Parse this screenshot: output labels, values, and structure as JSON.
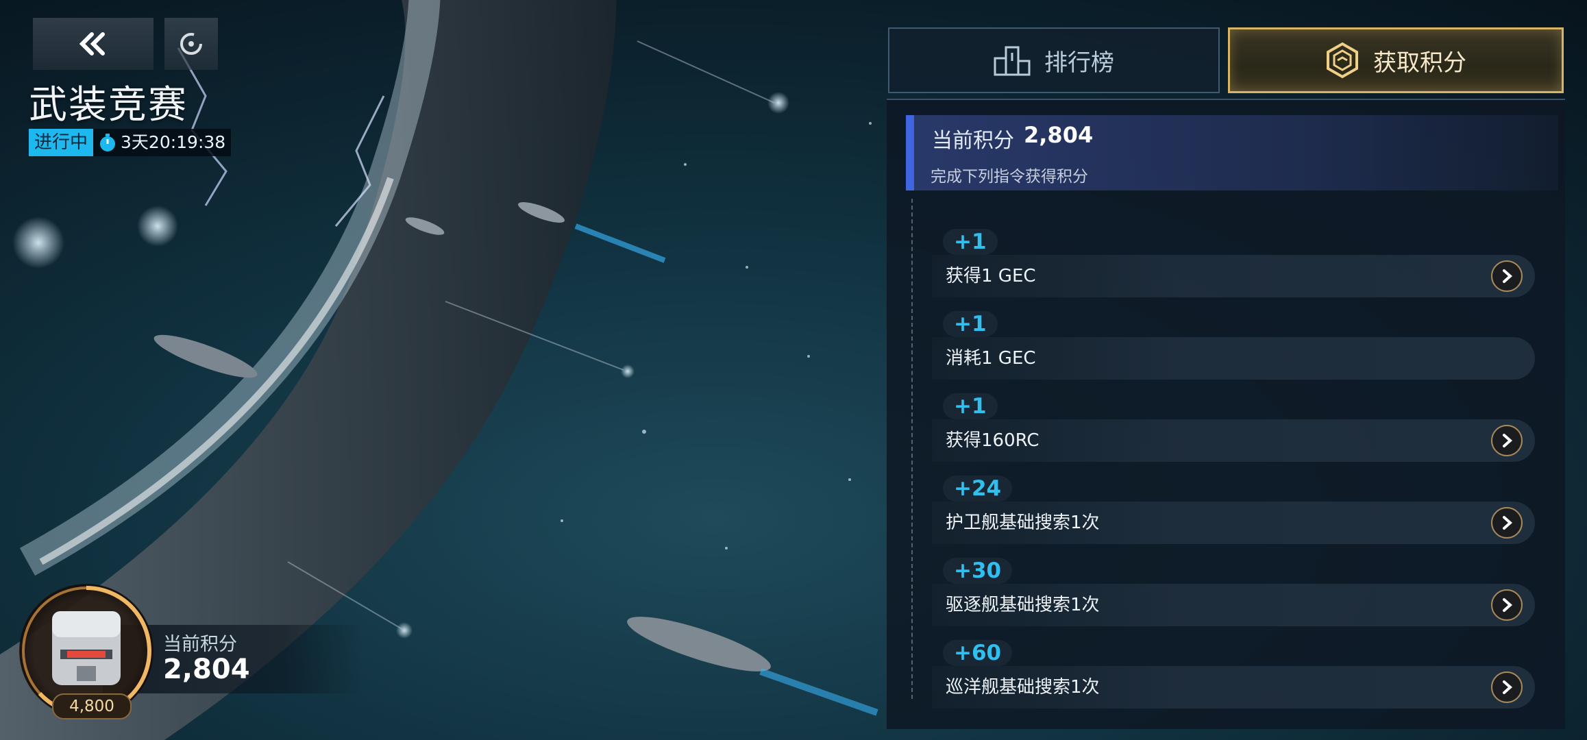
{
  "header": {
    "title": "武装竞赛",
    "status": "进行中",
    "timer": "3天20:19:38"
  },
  "icons": {
    "back": "double-chevron-left-icon",
    "refresh": "refresh-icon",
    "timer": "stopwatch-icon",
    "leaderboard": "podium-icon",
    "earn": "hexagon-points-icon",
    "go": "chevron-right-icon"
  },
  "reward": {
    "label": "当前积分",
    "value": "2,804",
    "target": "4,800"
  },
  "tabs": {
    "leaderboard": "排行榜",
    "earn": "获取积分"
  },
  "panel": {
    "current_label": "当前积分",
    "current_value": "2,804",
    "subtitle": "完成下列指令获得积分",
    "tasks": [
      {
        "points": "+1",
        "name": "获得1 GEC",
        "has_go": true
      },
      {
        "points": "+1",
        "name": "消耗1 GEC",
        "has_go": false
      },
      {
        "points": "+1",
        "name": "获得160RC",
        "has_go": true
      },
      {
        "points": "+24",
        "name": "护卫舰基础搜索1次",
        "has_go": true
      },
      {
        "points": "+30",
        "name": "驱逐舰基础搜索1次",
        "has_go": true
      },
      {
        "points": "+60",
        "name": "巡洋舰基础搜索1次",
        "has_go": true
      }
    ]
  },
  "colors": {
    "accent_blue": "#2fc0f0",
    "status_badge": "#1fb8ee",
    "gold": "#d8b467",
    "header_bar": "#3f66e0"
  }
}
